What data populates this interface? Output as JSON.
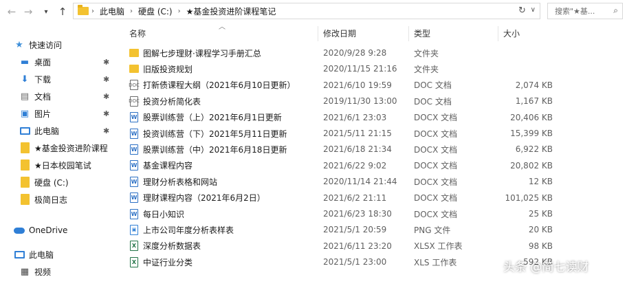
{
  "address": {
    "crumbs": [
      "此电脑",
      "硬盘 (C:)",
      "★基金投资进阶课程笔记"
    ],
    "search_placeholder": "搜索\"★基..."
  },
  "sidebar": {
    "quick_access": "快速访问",
    "items": [
      {
        "label": "桌面",
        "icon": "desktop-icon",
        "pinned": true
      },
      {
        "label": "下载",
        "icon": "download-icon",
        "pinned": true
      },
      {
        "label": "文档",
        "icon": "document-icon",
        "pinned": true
      },
      {
        "label": "图片",
        "icon": "picture-icon",
        "pinned": true
      },
      {
        "label": "此电脑",
        "icon": "computer-icon",
        "pinned": true
      },
      {
        "label": "★基金投资进阶课程",
        "icon": "folder-icon",
        "pinned": false
      },
      {
        "label": "★日本校园笔试",
        "icon": "folder-icon",
        "pinned": false
      },
      {
        "label": "硬盘 (C:)",
        "icon": "folder-icon",
        "pinned": false
      },
      {
        "label": "极简日志",
        "icon": "folder-icon",
        "pinned": false
      }
    ],
    "onedrive": "OneDrive",
    "this_pc": "此电脑",
    "network": "视频"
  },
  "columns": {
    "name": "名称",
    "date": "修改日期",
    "type": "类型",
    "size": "大小"
  },
  "files": [
    {
      "name": "图解七步理财·课程学习手册汇总",
      "date": "2020/9/28 9:28",
      "type": "文件夹",
      "size": "",
      "icon": "folder"
    },
    {
      "name": "旧版投资规划",
      "date": "2020/11/15 21:16",
      "type": "文件夹",
      "size": "",
      "icon": "folder"
    },
    {
      "name": "打新债课程大纲（2021年6月10日更新）",
      "date": "2021/6/10 19:59",
      "type": "DOC 文档",
      "size": "2,074 KB",
      "icon": "doc"
    },
    {
      "name": "投资分析简化表",
      "date": "2019/11/30 13:00",
      "type": "DOC 文档",
      "size": "1,167 KB",
      "icon": "doc"
    },
    {
      "name": "股票训练营（上）2021年6月1日更新",
      "date": "2021/6/1 23:03",
      "type": "DOCX 文档",
      "size": "20,406 KB",
      "icon": "word"
    },
    {
      "name": "投资训练营（下）2021年5月11日更新",
      "date": "2021/5/11 21:15",
      "type": "DOCX 文档",
      "size": "15,399 KB",
      "icon": "word"
    },
    {
      "name": "股票训练营（中）2021年6月18日更新",
      "date": "2021/6/18 21:34",
      "type": "DOCX 文档",
      "size": "6,922 KB",
      "icon": "word"
    },
    {
      "name": "基金课程内容",
      "date": "2021/6/22 9:02",
      "type": "DOCX 文档",
      "size": "20,802 KB",
      "icon": "word"
    },
    {
      "name": "理财分析表格和网站",
      "date": "2020/11/14 21:44",
      "type": "DOCX 文档",
      "size": "12 KB",
      "icon": "word"
    },
    {
      "name": "理财课程内容（2021年6月2日）",
      "date": "2021/6/2 21:11",
      "type": "DOCX 文档",
      "size": "101,025 KB",
      "icon": "word"
    },
    {
      "name": "每日小知识",
      "date": "2021/6/23 18:30",
      "type": "DOCX 文档",
      "size": "25 KB",
      "icon": "word"
    },
    {
      "name": "上市公司年度分析表样表",
      "date": "2021/5/1 20:59",
      "type": "PNG 文件",
      "size": "20 KB",
      "icon": "png"
    },
    {
      "name": "深度分析数据表",
      "date": "2021/6/11 23:20",
      "type": "XLSX 工作表",
      "size": "98 KB",
      "icon": "xls"
    },
    {
      "name": "中证行业分类",
      "date": "2021/5/1 23:00",
      "type": "XLS 工作表",
      "size": "592 KB",
      "icon": "xls"
    }
  ],
  "watermark": "头条 @简七读财"
}
